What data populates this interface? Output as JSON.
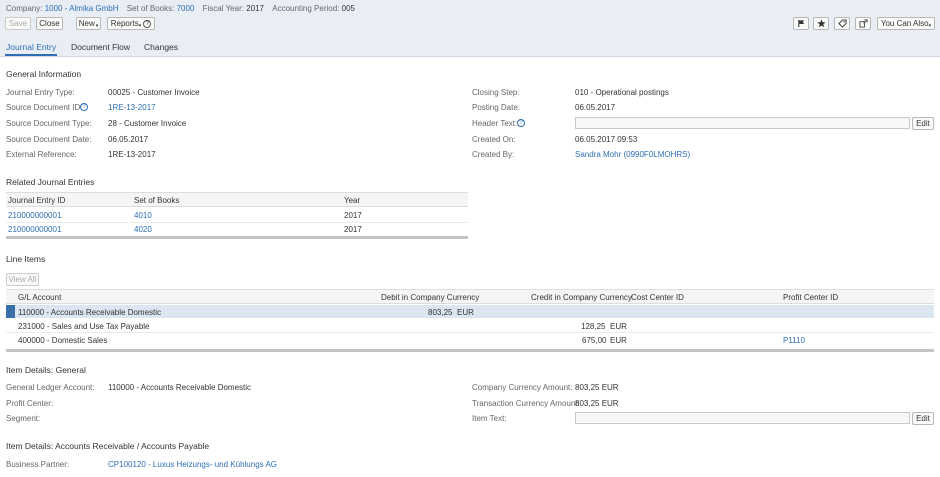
{
  "header": {
    "company_label": "Company:",
    "company_value": "1000 - Almika GmbH",
    "books_label": "Set of Books:",
    "books_value": "7000",
    "fiscal_label": "Fiscal Year:",
    "fiscal_value": "2017",
    "period_label": "Accounting Period:",
    "period_value": "005"
  },
  "toolbar": {
    "save": "Save",
    "close": "Close",
    "new": "New",
    "reports": "Reports",
    "you_can_also": "You Can Also"
  },
  "tabs": [
    "Journal Entry",
    "Document Flow",
    "Changes"
  ],
  "general": {
    "title": "General Information",
    "left": [
      {
        "label": "Journal Entry Type:",
        "value": "00025 - Customer Invoice"
      },
      {
        "label": "Source Document ID:",
        "value": "1RE-13-2017"
      },
      {
        "label": "Source Document Type:",
        "value": "28 - Customer Invoice"
      },
      {
        "label": "Source Document Date:",
        "value": "06.05.2017"
      },
      {
        "label": "External Reference:",
        "value": "1RE-13-2017"
      }
    ],
    "right": [
      {
        "label": "Closing Step:",
        "value": "010 - Operational postings"
      },
      {
        "label": "Posting Date:",
        "value": "06.05.2017"
      },
      {
        "label": "Header Text:",
        "value": ""
      },
      {
        "label": "Created On:",
        "value": "06.05.2017 09:53"
      },
      {
        "label": "Created By:",
        "value": "Sandra Mohr (0990F0LMOHRS)"
      }
    ],
    "edit": "Edit"
  },
  "related": {
    "title": "Related Journal Entries",
    "columns": [
      "Journal Entry ID",
      "Set of Books",
      "Year"
    ],
    "rows": [
      [
        "210000000001",
        "4010",
        "2017"
      ],
      [
        "210000000001",
        "4020",
        "2017"
      ]
    ]
  },
  "line_items": {
    "title": "Line Items",
    "view_all": "View All",
    "columns": [
      "G/L Account",
      "Debit in Company Currency",
      "Credit in Company Currency",
      "Cost Center ID",
      "Profit Center ID"
    ],
    "rows": [
      {
        "account": "110000 - Accounts Receivable Domestic",
        "debit": "803,25",
        "debit_cur": "EUR",
        "credit": "",
        "credit_cur": "",
        "cost_center": "",
        "profit_center": ""
      },
      {
        "account": "231000 - Sales and Use Tax Payable",
        "debit": "",
        "debit_cur": "",
        "credit": "128,25",
        "credit_cur": "EUR",
        "cost_center": "",
        "profit_center": ""
      },
      {
        "account": "400000 - Domestic Sales",
        "debit": "",
        "debit_cur": "",
        "credit": "675,00",
        "credit_cur": "EUR",
        "cost_center": "",
        "profit_center": "P1110"
      }
    ]
  },
  "item_general": {
    "title": "Item Details: General",
    "left": [
      {
        "label": "General Ledger Account:",
        "value": "110000 - Accounts Receivable Domestic"
      },
      {
        "label": "Profit Center:",
        "value": ""
      },
      {
        "label": "Segment:",
        "value": ""
      }
    ],
    "right": [
      {
        "label": "Company Currency Amount:",
        "value": "803,25 EUR"
      },
      {
        "label": "Transaction Currency Amount:",
        "value": "803,25 EUR"
      },
      {
        "label": "Item Text:",
        "value": ""
      }
    ],
    "edit": "Edit"
  },
  "item_ar": {
    "title": "Item Details: Accounts Receivable / Accounts Payable",
    "label": "Business Partner:",
    "value": "CP100120 - Luxus Heizungs- und Kühlungs AG"
  }
}
